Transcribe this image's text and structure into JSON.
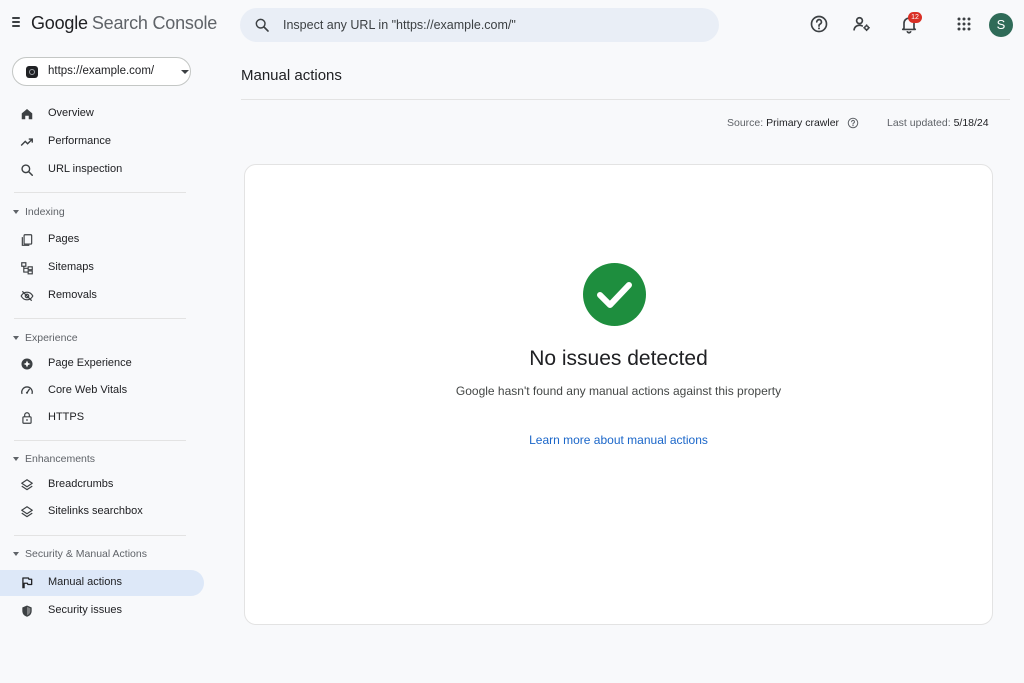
{
  "header": {
    "logo_google": "Google",
    "logo_product": "Search Console",
    "search_placeholder": "Inspect any URL in \"https://example.com/\"",
    "notification_count": "12",
    "avatar_initial": "S"
  },
  "property": {
    "label": "https://example.com/"
  },
  "sidebar": {
    "items": [
      {
        "label": "Overview",
        "icon": "home-icon"
      },
      {
        "label": "Performance",
        "icon": "trending-up-icon"
      },
      {
        "label": "URL inspection",
        "icon": "search-icon"
      }
    ],
    "sections": [
      {
        "label": "Indexing",
        "items": [
          {
            "label": "Pages",
            "icon": "pages-icon"
          },
          {
            "label": "Sitemaps",
            "icon": "sitemap-icon"
          },
          {
            "label": "Removals",
            "icon": "eye-off-icon"
          }
        ]
      },
      {
        "label": "Experience",
        "items": [
          {
            "label": "Page Experience",
            "icon": "experience-icon"
          },
          {
            "label": "Core Web Vitals",
            "icon": "gauge-icon"
          },
          {
            "label": "HTTPS",
            "icon": "lock-icon"
          }
        ]
      },
      {
        "label": "Enhancements",
        "items": [
          {
            "label": "Breadcrumbs",
            "icon": "layers-icon"
          },
          {
            "label": "Sitelinks searchbox",
            "icon": "layers-icon"
          }
        ]
      },
      {
        "label": "Security & Manual Actions",
        "items": [
          {
            "label": "Manual actions",
            "icon": "flag-icon",
            "active": true
          },
          {
            "label": "Security issues",
            "icon": "shield-icon"
          }
        ]
      }
    ]
  },
  "main": {
    "title": "Manual actions",
    "source_label": "Source:",
    "source_value": "Primary crawler",
    "updated_label": "Last updated:",
    "updated_value": "5/18/24",
    "card": {
      "title": "No issues detected",
      "subtitle": "Google hasn't found any manual actions against this property",
      "link": "Learn more about manual actions",
      "status_icon": "check-circle-icon"
    }
  },
  "colors": {
    "accent": "#1a66c9",
    "success": "#1e8e3e",
    "active_nav": "#dde8f8",
    "badge": "#d93025",
    "avatar": "#2f6b58"
  }
}
